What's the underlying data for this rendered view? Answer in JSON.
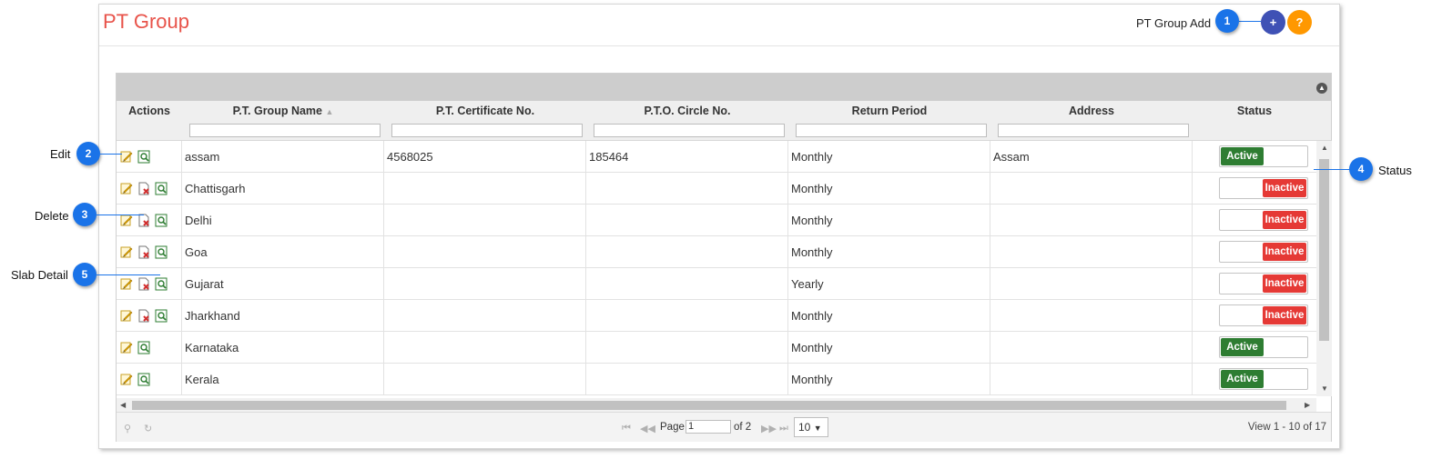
{
  "header": {
    "title": "PT Group",
    "add_label": "PT Group Add",
    "add_symbol": "+",
    "help_symbol": "?"
  },
  "columns": [
    {
      "label": "Actions"
    },
    {
      "label": "P.T. Group Name",
      "sort_icon": "sort-icon"
    },
    {
      "label": "P.T. Certificate No."
    },
    {
      "label": "P.T.O. Circle No."
    },
    {
      "label": "Return Period"
    },
    {
      "label": "Address"
    },
    {
      "label": "Status"
    }
  ],
  "rows": [
    {
      "name": "assam",
      "certificate": "4568025",
      "circle": "185464",
      "period": "Monthly",
      "address": "Assam",
      "status": "Active",
      "actions": [
        "edit-icon",
        "slab-detail-icon"
      ]
    },
    {
      "name": "Chattisgarh",
      "certificate": "",
      "circle": "",
      "period": "Monthly",
      "address": "",
      "status": "Inactive",
      "actions": [
        "edit-icon",
        "delete-icon",
        "slab-detail-icon"
      ]
    },
    {
      "name": "Delhi",
      "certificate": "",
      "circle": "",
      "period": "Monthly",
      "address": "",
      "status": "Inactive",
      "actions": [
        "edit-icon",
        "delete-icon",
        "slab-detail-icon"
      ]
    },
    {
      "name": "Goa",
      "certificate": "",
      "circle": "",
      "period": "Monthly",
      "address": "",
      "status": "Inactive",
      "actions": [
        "edit-icon",
        "delete-icon",
        "slab-detail-icon"
      ]
    },
    {
      "name": "Gujarat",
      "certificate": "",
      "circle": "",
      "period": "Yearly",
      "address": "",
      "status": "Inactive",
      "actions": [
        "edit-icon",
        "delete-icon",
        "slab-detail-icon"
      ]
    },
    {
      "name": "Jharkhand",
      "certificate": "",
      "circle": "",
      "period": "Monthly",
      "address": "",
      "status": "Inactive",
      "actions": [
        "edit-icon",
        "delete-icon",
        "slab-detail-icon"
      ]
    },
    {
      "name": "Karnataka",
      "certificate": "",
      "circle": "",
      "period": "Monthly",
      "address": "",
      "status": "Active",
      "actions": [
        "edit-icon",
        "slab-detail-icon"
      ]
    },
    {
      "name": "Kerala",
      "certificate": "",
      "circle": "",
      "period": "Monthly",
      "address": "",
      "status": "Active",
      "actions": [
        "edit-icon",
        "slab-detail-icon"
      ]
    }
  ],
  "pager": {
    "page_label": "Page",
    "page_value": "1",
    "of_label": "of 2",
    "rows_per_page": "10",
    "view_text": "View 1 - 10 of 17"
  },
  "callouts": [
    {
      "num": "1",
      "label": ""
    },
    {
      "num": "2",
      "label": "Edit"
    },
    {
      "num": "3",
      "label": "Delete"
    },
    {
      "num": "4",
      "label": "Status"
    },
    {
      "num": "5",
      "label": "Slab Detail"
    }
  ],
  "colors": {
    "title": "#e8534a",
    "active": "#2e7d32",
    "inactive": "#e53935",
    "callout": "#1a73e8",
    "add_button": "#3f51b5",
    "help_button": "#ff9800"
  }
}
